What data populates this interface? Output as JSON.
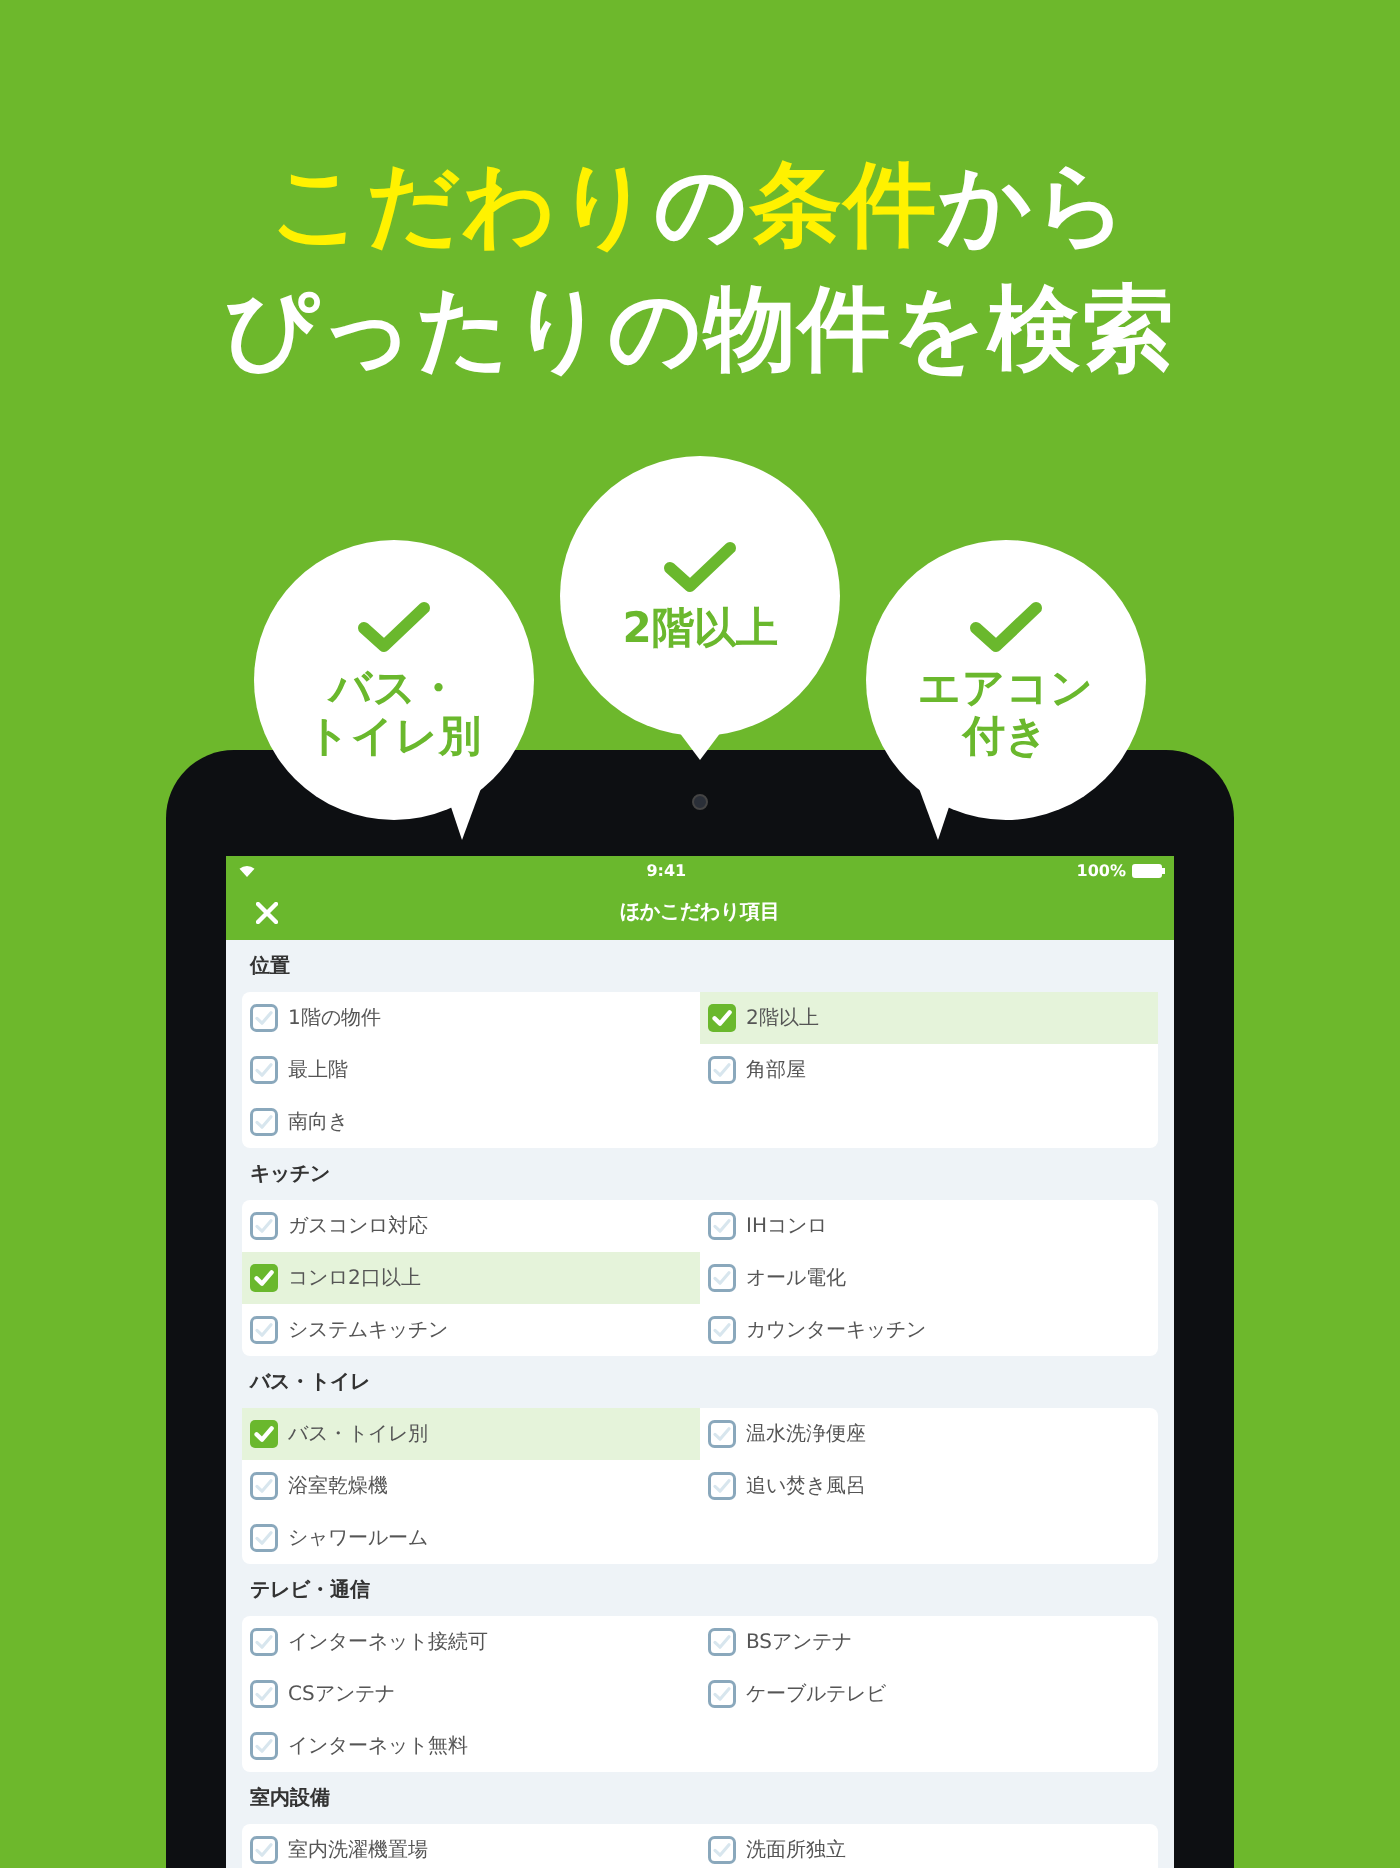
{
  "headline": [
    [
      {
        "text": "こだわり",
        "highlight": true
      },
      {
        "text": "の",
        "highlight": false
      },
      {
        "text": "条件",
        "highlight": true
      },
      {
        "text": "から",
        "highlight": false
      }
    ],
    [
      {
        "text": "ぴったりの物件を検索",
        "highlight": false
      }
    ]
  ],
  "bubbles": [
    {
      "lines": [
        "バス・",
        "トイレ別"
      ]
    },
    {
      "lines": [
        "2階以上"
      ]
    },
    {
      "lines": [
        "エアコン",
        "付き"
      ]
    }
  ],
  "status_bar": {
    "time": "9:41",
    "battery": "100%"
  },
  "nav": {
    "title": "ほかこだわり項目"
  },
  "sections": [
    {
      "title": "位置",
      "items": [
        {
          "label": "1階の物件",
          "checked": false
        },
        {
          "label": "2階以上",
          "checked": true
        },
        {
          "label": "最上階",
          "checked": false
        },
        {
          "label": "角部屋",
          "checked": false
        },
        {
          "label": "南向き",
          "checked": false
        }
      ]
    },
    {
      "title": "キッチン",
      "items": [
        {
          "label": "ガスコンロ対応",
          "checked": false
        },
        {
          "label": "IHコンロ",
          "checked": false
        },
        {
          "label": "コンロ2口以上",
          "checked": true
        },
        {
          "label": "オール電化",
          "checked": false
        },
        {
          "label": "システムキッチン",
          "checked": false
        },
        {
          "label": "カウンターキッチン",
          "checked": false
        }
      ]
    },
    {
      "title": "バス・トイレ",
      "items": [
        {
          "label": "バス・トイレ別",
          "checked": true
        },
        {
          "label": "温水洗浄便座",
          "checked": false
        },
        {
          "label": "浴室乾燥機",
          "checked": false
        },
        {
          "label": "追い焚き風呂",
          "checked": false
        },
        {
          "label": "シャワールーム",
          "checked": false
        }
      ]
    },
    {
      "title": "テレビ・通信",
      "items": [
        {
          "label": "インターネット接続可",
          "checked": false
        },
        {
          "label": "BSアンテナ",
          "checked": false
        },
        {
          "label": "CSアンテナ",
          "checked": false
        },
        {
          "label": "ケーブルテレビ",
          "checked": false
        },
        {
          "label": "インターネット無料",
          "checked": false
        }
      ]
    },
    {
      "title": "室内設備",
      "items": [
        {
          "label": "室内洗濯機置場",
          "checked": false
        },
        {
          "label": "洗面所独立",
          "checked": false
        }
      ]
    }
  ]
}
